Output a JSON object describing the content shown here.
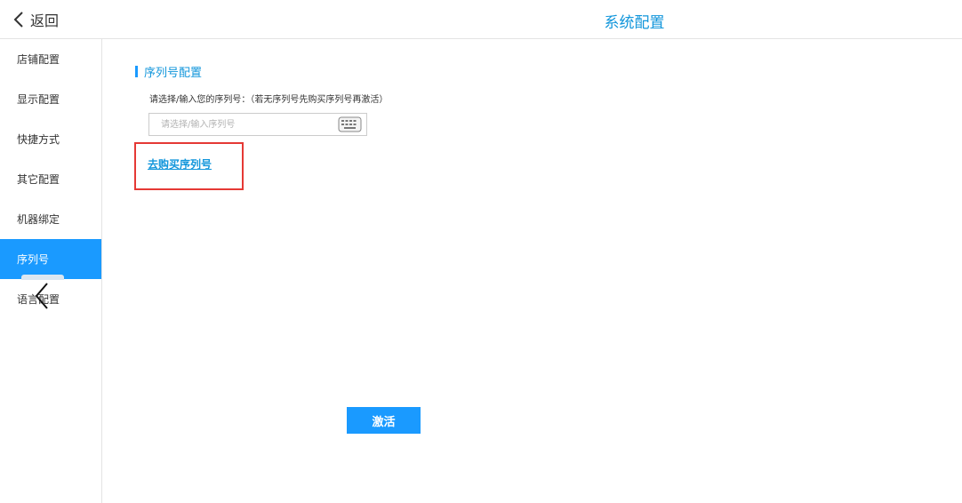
{
  "header": {
    "back_label": "返回",
    "title": "系统配置",
    "back_icon": "chevron-left-icon"
  },
  "sidebar": {
    "items": [
      {
        "label": "店铺配置",
        "active": false
      },
      {
        "label": "显示配置",
        "active": false
      },
      {
        "label": "快捷方式",
        "active": false
      },
      {
        "label": "其它配置",
        "active": false
      },
      {
        "label": "机器绑定",
        "active": false
      },
      {
        "label": "序列号",
        "active": true
      },
      {
        "label": "语言配置",
        "active": false
      }
    ]
  },
  "floating_back": {
    "icon": "chevron-left-icon"
  },
  "main": {
    "section_title": "序列号配置",
    "hint": "请选择/输入您的序列号：（若无序列号先购买序列号再激活）",
    "serial_input": {
      "placeholder": "请选择/输入序列号",
      "value": ""
    },
    "keyboard_icon": "keyboard-icon",
    "buy_link": "去购买序列号",
    "activate_label": "激活"
  },
  "colors": {
    "accent": "#1a9aff",
    "title_blue": "#1296db",
    "highlight_red": "#e53935",
    "border": "#e3e3e3"
  }
}
